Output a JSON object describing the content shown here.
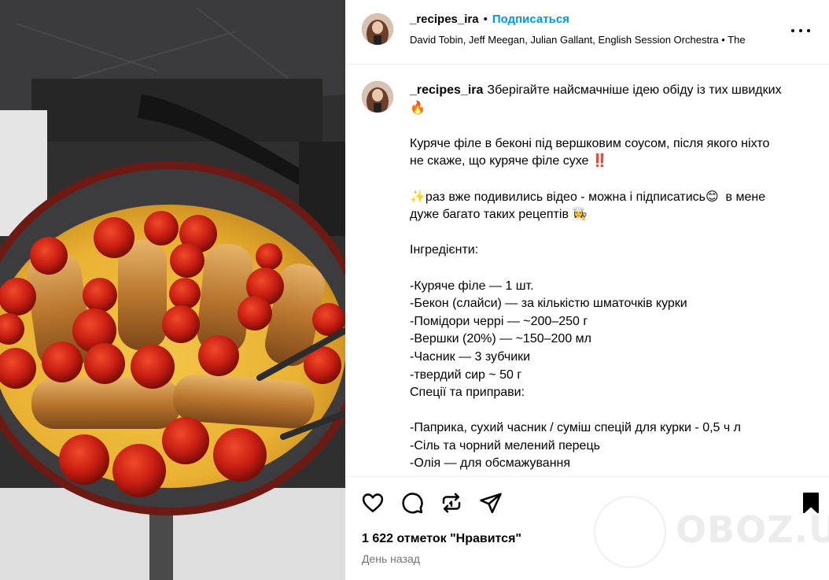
{
  "post": {
    "username": "_recipes_ira",
    "follow_label": "Подписаться",
    "audio": "David Tobin, Jeff Meegan, Julian Gallant, English Session Orchestra • The",
    "caption_first": "Зберігайте найсмачніше ідею обіду із тих швидких",
    "caption_lines": [
      "🔥",
      "",
      "Куряче філе в беконі під вершковим соусом, після якого ніхто",
      "не скаже, що куряче філе сухе ‼️",
      "",
      "✨раз вже подивились відео - можна і підписатись😊  в мене",
      "дуже багато таких рецептів 👩‍🍳",
      "",
      "Інгредієнти:",
      "",
      "-Куряче філе — 1 шт.",
      "-Бекон (слайси) — за кількістю шматочків курки",
      "-Помідори черрі — ~200–250 г",
      "-Вершки (20%) — ~150–200 мл",
      "-Часник — 3 зубчики",
      "-твердий сир ~ 50 г",
      "Спеції та приправи:",
      "",
      "-Паприка, сухий часник / суміш спецій для курки - 0,5 ч л",
      "-Сіль та чорний мелений перець",
      "-Олія — для обсмажування"
    ],
    "likes": "1 622 отметок \"Нравится\"",
    "time": "День назад"
  },
  "watermark": {
    "text": "OBOZ.UA"
  },
  "icons": {
    "like": "heart-icon",
    "comment": "comment-icon",
    "repost": "repost-icon",
    "share": "send-icon",
    "save": "bookmark-icon",
    "more": "more-options-icon"
  },
  "colors": {
    "accent": "#0095f6",
    "muted": "#737373",
    "divider": "#efefef"
  }
}
